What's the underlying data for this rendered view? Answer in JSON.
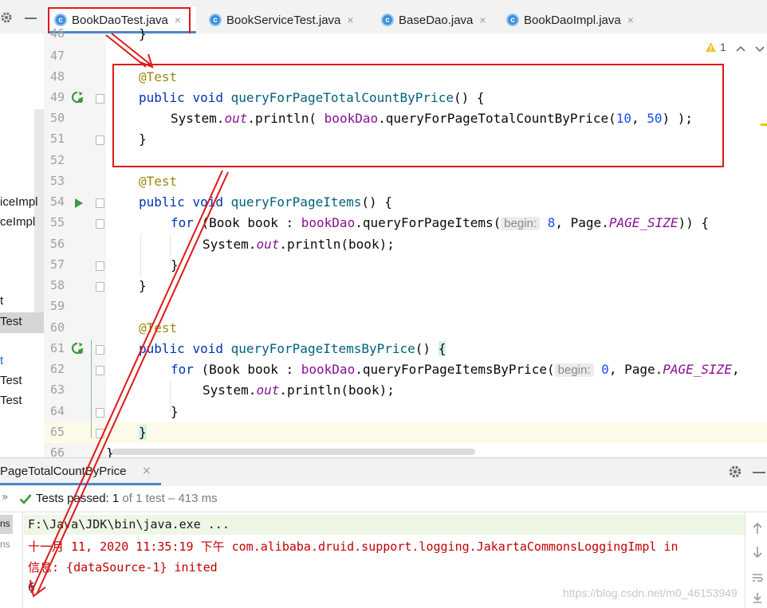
{
  "tabs": [
    {
      "label": "BookDaoTest.java",
      "close": "×",
      "active": true
    },
    {
      "label": "BookServiceTest.java",
      "close": "×",
      "active": false
    },
    {
      "label": "BaseDao.java",
      "close": "×",
      "active": false
    },
    {
      "label": "BookDaoImpl.java",
      "close": "×",
      "active": false
    }
  ],
  "tab_icon_letter": "c",
  "warnings": {
    "count": "1"
  },
  "project_fragments": [
    "iceImpl",
    "ceImpl",
    "t",
    "Test",
    "t",
    "Test",
    "Test"
  ],
  "line_numbers": [
    "46",
    "47",
    "48",
    "49",
    "50",
    "51",
    "52",
    "53",
    "54",
    "55",
    "56",
    "57",
    "58",
    "59",
    "60",
    "61",
    "62",
    "63",
    "64",
    "65",
    "66"
  ],
  "code": {
    "l46": "}",
    "l48_annot": "@Test",
    "l49_kw1": "public",
    "l49_kw2": "void",
    "l49_name": "queryForPageTotalCountByPrice",
    "l49_rest": "() {",
    "l50_a": "System.",
    "l50_out": "out",
    "l50_b": ".println( ",
    "l50_field": "bookDao",
    "l50_c": ".queryForPageTotalCountByPrice(",
    "l50_n1": "10",
    "l50_d": ", ",
    "l50_n2": "50",
    "l50_e": ") );",
    "l51": "}",
    "l53_annot": "@Test",
    "l54_kw1": "public",
    "l54_kw2": "void",
    "l54_name": "queryForPageItems",
    "l54_rest": "() {",
    "l55_for": "for",
    "l55_a": " (Book book : ",
    "l55_field": "bookDao",
    "l55_b": ".queryForPageItems(",
    "l55_hint": "begin:",
    "l55_n": "8",
    "l55_c": ", Page.",
    "l55_const": "PAGE_SIZE",
    "l55_d": ")) {",
    "l56_a": "System.",
    "l56_out": "out",
    "l56_b": ".println(book);",
    "l57": "}",
    "l58": "}",
    "l60_annot": "@Test",
    "l61_kw1": "public",
    "l61_kw2": "void",
    "l61_name": "queryForPageItemsByPrice",
    "l61_rest": "() ",
    "l61_brace": "{",
    "l62_for": "for",
    "l62_a": " (Book book : ",
    "l62_field": "bookDao",
    "l62_b": ".queryForPageItemsByPrice(",
    "l62_hint": "begin:",
    "l62_n": "0",
    "l62_c": ", Page.",
    "l62_const": "PAGE_SIZE",
    "l62_d": ",",
    "l63_a": "System.",
    "l63_out": "out",
    "l63_b": ".println(book);",
    "l64": "}",
    "l65": "}",
    "l66": "}"
  },
  "run_panel": {
    "tab_label": "PageTotalCountByPrice",
    "tab_close": "×",
    "chevrons": "»",
    "status_prefix": "Tests passed: ",
    "status_count": "1",
    "status_rest": " of 1 test – 413 ms",
    "side_labels": [
      "ns",
      "ns"
    ]
  },
  "console": {
    "line1": "F:\\Java\\JDK\\bin\\java.exe ...",
    "line2": "十一月 11, 2020 11:35:19 下午 com.alibaba.druid.support.logging.JakartaCommonsLoggingImpl in",
    "line3": "信息: {dataSource-1} inited",
    "line4": "6"
  },
  "watermark": "https://blog.csdn.net/m0_46153949",
  "colors": {
    "accent": "#4a88c7",
    "annotation_box": "#e01818",
    "pass_green": "#3c9a3c"
  }
}
